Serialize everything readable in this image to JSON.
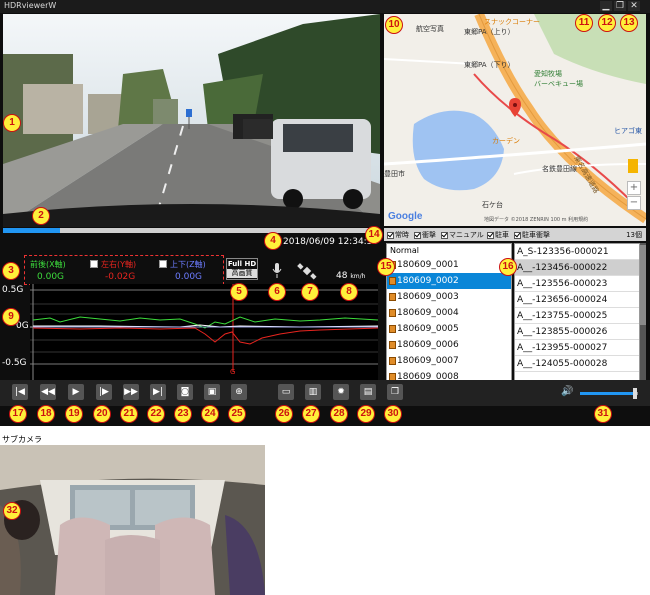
{
  "window": {
    "title": "HDRviewerW",
    "controls": [
      "minimize-icon",
      "restore-icon",
      "close-icon"
    ]
  },
  "video": {
    "progress_fraction": 0.15
  },
  "map": {
    "labels": {
      "aerial": "航空写真",
      "snack": "スナックコーナー",
      "parking_up": "東郷PA（上り）",
      "parking_down": "東郷PA（下り）",
      "farm": "愛知牧場",
      "barbecue": "バーベキュー場",
      "carden": "カーデン",
      "meitetsu": "名鉄豊田線",
      "hiaga": "ヒアゴ東",
      "toyota": "豊田市",
      "ishigadai": "石ケ台",
      "expressway": "東名高速道路"
    },
    "google": "Google",
    "copyright": "地図データ ©2018 ZENRIN   100 m   利用規約"
  },
  "filters": {
    "items": [
      "常時",
      "衝撃",
      "マニュアル",
      "駐車",
      "駐車衝撃"
    ],
    "count": "13個"
  },
  "info": {
    "datetime": "2018/06/09 12:34:50",
    "axes": [
      {
        "name": "前後(X軸)",
        "value": "0.00G",
        "color": "#3ddc3d"
      },
      {
        "name": "左右(Y軸)",
        "value": "-0.02G",
        "color": "#e8251f"
      },
      {
        "name": "上下(Z軸)",
        "value": "0.00G",
        "color": "#6c7cff"
      }
    ],
    "quality_top": "Full HD",
    "quality_bottom": "高画質",
    "speed_value": "48",
    "speed_unit": "km/h"
  },
  "graph": {
    "labels": [
      "0.5G",
      "0G",
      "-0.5G"
    ],
    "marker": "G"
  },
  "file_list": {
    "header": "Normal",
    "items": [
      {
        "name": "180609_0001",
        "selected": false
      },
      {
        "name": "180609_0002",
        "selected": true
      },
      {
        "name": "180609_0003",
        "selected": false
      },
      {
        "name": "180609_0004",
        "selected": false
      },
      {
        "name": "180609_0005",
        "selected": false
      },
      {
        "name": "180609_0006",
        "selected": false
      },
      {
        "name": "180609_0007",
        "selected": false
      },
      {
        "name": "180609_0008",
        "selected": false
      }
    ]
  },
  "clip_list": {
    "items": [
      {
        "name": "A_S-123356-000021",
        "selected": false
      },
      {
        "name": "A__-123456-000022",
        "selected": true
      },
      {
        "name": "A__-123556-000023",
        "selected": false
      },
      {
        "name": "A__-123656-000024",
        "selected": false
      },
      {
        "name": "A__-123755-000025",
        "selected": false
      },
      {
        "name": "A__-123855-000026",
        "selected": false
      },
      {
        "name": "A__-123955-000027",
        "selected": false
      },
      {
        "name": "A__-124055-000028",
        "selected": false
      }
    ]
  },
  "toolbar": {
    "playback": [
      {
        "name": "skip-start-icon",
        "glyph": "|◀"
      },
      {
        "name": "rewind-icon",
        "glyph": "◀◀"
      },
      {
        "name": "play-icon",
        "glyph": "▶"
      },
      {
        "name": "step-back-icon",
        "glyph": "|▶"
      },
      {
        "name": "fast-forward-icon",
        "glyph": "▶▶"
      },
      {
        "name": "skip-end-icon",
        "glyph": "▶|"
      },
      {
        "name": "camera-icon",
        "glyph": "◙"
      },
      {
        "name": "video-camera-icon",
        "glyph": "▣"
      },
      {
        "name": "zoom-icon",
        "glyph": "⊕"
      }
    ],
    "tools": [
      {
        "name": "folder-icon",
        "glyph": "▭"
      },
      {
        "name": "trash-icon",
        "glyph": "▥"
      },
      {
        "name": "settings-icon",
        "glyph": "✹"
      },
      {
        "name": "export-icon",
        "glyph": "▤"
      },
      {
        "name": "window-icon",
        "glyph": "❐"
      }
    ],
    "volume_level": 0.95
  },
  "subcam": {
    "label": "サブカメラ"
  },
  "callouts": [
    "1",
    "2",
    "3",
    "4",
    "5",
    "6",
    "7",
    "8",
    "9",
    "10",
    "11",
    "12",
    "13",
    "14",
    "15",
    "16",
    "17",
    "18",
    "19",
    "20",
    "21",
    "22",
    "23",
    "24",
    "25",
    "26",
    "27",
    "28",
    "29",
    "30",
    "31",
    "32"
  ]
}
